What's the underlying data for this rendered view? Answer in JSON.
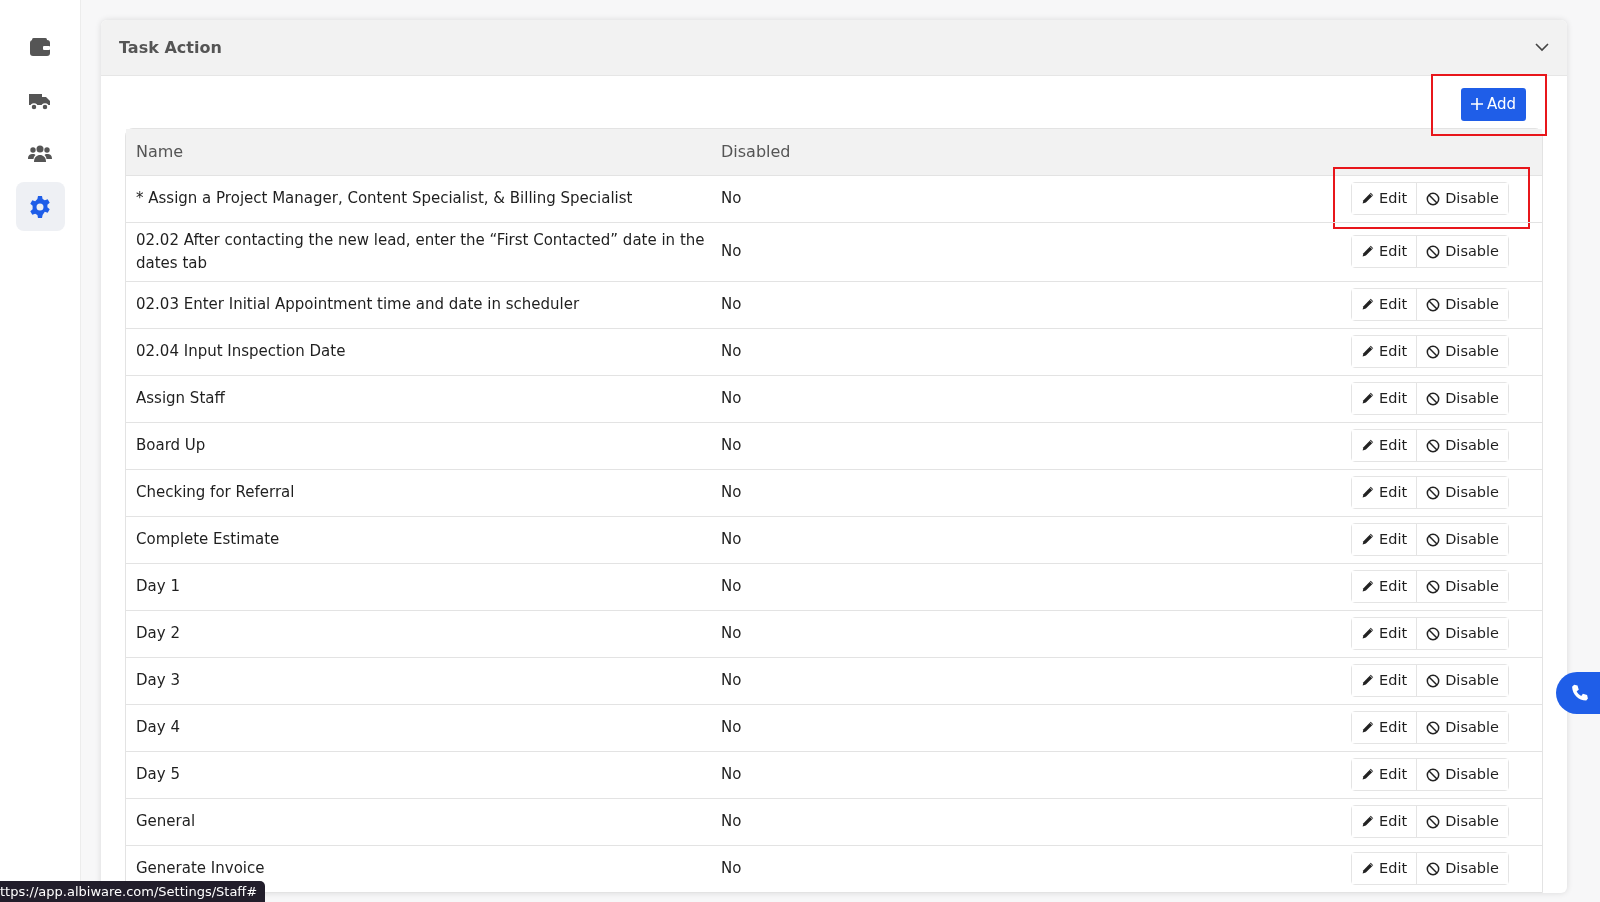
{
  "sidebar": {
    "items": [
      {
        "selected": false
      },
      {
        "selected": false
      },
      {
        "selected": false
      },
      {
        "selected": true
      }
    ]
  },
  "panel": {
    "title": "Task Action",
    "expanded": true,
    "add_button": {
      "label": "Add",
      "highlighted": true
    },
    "table": {
      "columns": [
        "Name",
        "Disabled"
      ],
      "rows": [
        {
          "name": "* Assign a Project Manager, Content Specialist, & Billing Specialist",
          "disabled": "No",
          "actions": [
            "Edit",
            "Disable"
          ],
          "highlighted": true
        },
        {
          "name": "02.02 After contacting the new lead, enter the “First Contacted” date in the dates tab",
          "disabled": "No",
          "actions": [
            "Edit",
            "Disable"
          ],
          "highlighted": false
        },
        {
          "name": "02.03 Enter Initial Appointment time and date in scheduler",
          "disabled": "No",
          "actions": [
            "Edit",
            "Disable"
          ],
          "highlighted": false
        },
        {
          "name": "02.04 Input Inspection Date",
          "disabled": "No",
          "actions": [
            "Edit",
            "Disable"
          ],
          "highlighted": false
        },
        {
          "name": "Assign Staff",
          "disabled": "No",
          "actions": [
            "Edit",
            "Disable"
          ],
          "highlighted": false
        },
        {
          "name": "Board Up",
          "disabled": "No",
          "actions": [
            "Edit",
            "Disable"
          ],
          "highlighted": false
        },
        {
          "name": "Checking for Referral",
          "disabled": "No",
          "actions": [
            "Edit",
            "Disable"
          ],
          "highlighted": false
        },
        {
          "name": "Complete Estimate",
          "disabled": "No",
          "actions": [
            "Edit",
            "Disable"
          ],
          "highlighted": false
        },
        {
          "name": "Day 1",
          "disabled": "No",
          "actions": [
            "Edit",
            "Disable"
          ],
          "highlighted": false
        },
        {
          "name": "Day 2",
          "disabled": "No",
          "actions": [
            "Edit",
            "Disable"
          ],
          "highlighted": false
        },
        {
          "name": "Day 3",
          "disabled": "No",
          "actions": [
            "Edit",
            "Disable"
          ],
          "highlighted": false
        },
        {
          "name": "Day 4",
          "disabled": "No",
          "actions": [
            "Edit",
            "Disable"
          ],
          "highlighted": false
        },
        {
          "name": "Day 5",
          "disabled": "No",
          "actions": [
            "Edit",
            "Disable"
          ],
          "highlighted": false
        },
        {
          "name": "General",
          "disabled": "No",
          "actions": [
            "Edit",
            "Disable"
          ],
          "highlighted": false
        },
        {
          "name": "Generate Invoice",
          "disabled": "No",
          "actions": [
            "Edit",
            "Disable"
          ],
          "highlighted": false
        }
      ]
    }
  },
  "status_link": "ttps://app.albiware.com/Settings/Staff#"
}
